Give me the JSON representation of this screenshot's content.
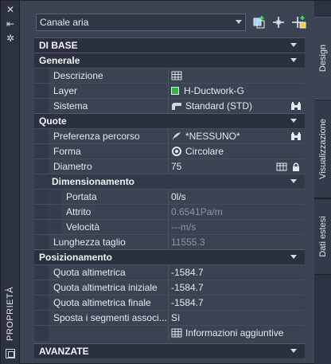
{
  "palette": {
    "title": "PROPRIETÀ",
    "tabs": [
      "Design",
      "Visualizzazione",
      "Dati estesi"
    ]
  },
  "toolbar": {
    "object_type": "Canale aria"
  },
  "categories": {
    "base": "DI BASE",
    "generale": "Generale",
    "quote": "Quote",
    "dimensionamento": "Dimensionamento",
    "posizionamento": "Posizionamento",
    "avanzate": "AVANZATE"
  },
  "props": {
    "descrizione": {
      "name": "Descrizione",
      "value": ""
    },
    "layer": {
      "name": "Layer",
      "value": "H-Ductwork-G",
      "color": "#2db83d"
    },
    "sistema": {
      "name": "Sistema",
      "value": "Standard (STD)"
    },
    "preferenza": {
      "name": "Preferenza percorso",
      "value": "*NESSUNO*"
    },
    "forma": {
      "name": "Forma",
      "value": "Circolare"
    },
    "diametro": {
      "name": "Diametro",
      "value": "75"
    },
    "portata": {
      "name": "Portata",
      "value": "0l/s"
    },
    "attrito": {
      "name": "Attrito",
      "value": "0.6541Pa/m"
    },
    "velocita": {
      "name": "Velocità",
      "value": "---m/s"
    },
    "lunghezza": {
      "name": "Lunghezza taglio",
      "value": "11555.3"
    },
    "quota_alt": {
      "name": "Quota altimetrica",
      "value": "-1584.7"
    },
    "quota_ini": {
      "name": "Quota altimetrica iniziale",
      "value": "-1584.7"
    },
    "quota_fin": {
      "name": "Quota altimetrica finale",
      "value": "-1584.7"
    },
    "sposta": {
      "name": "Sposta i segmenti associ...",
      "value": "Sì"
    },
    "info": {
      "name": "",
      "value": "Informazioni aggiuntive"
    }
  }
}
